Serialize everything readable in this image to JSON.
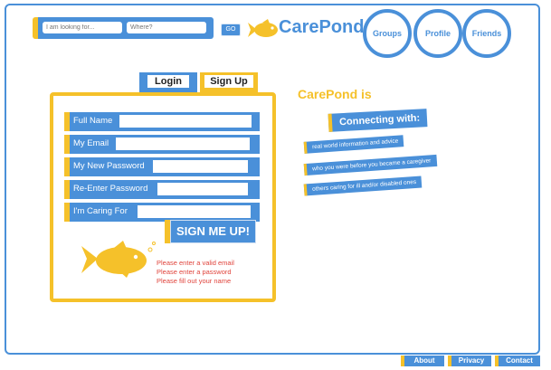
{
  "search": {
    "keyword_placeholder": "I am looking for...",
    "where_placeholder": "Where?",
    "go_label": "GO"
  },
  "brand": {
    "name": "CarePond"
  },
  "nav": {
    "groups": "Groups",
    "profile": "Profile",
    "friends": "Friends"
  },
  "tabs": {
    "login": "Login",
    "signup": "Sign Up"
  },
  "form": {
    "fields": [
      {
        "label": "Full Name"
      },
      {
        "label": "My Email"
      },
      {
        "label": "My New Password"
      },
      {
        "label": "Re-Enter Password"
      },
      {
        "label": "I'm Caring For"
      }
    ],
    "submit_label": "SIGN ME UP!",
    "errors": [
      "Please enter a valid email",
      "Please enter a password",
      "Please fill out your name"
    ]
  },
  "promo": {
    "tagline": "CarePond is",
    "heading": "Connecting with:",
    "items": [
      "real world information and advice",
      "who you were before you became a caregiver",
      "others caring for ill and/or disabled ones"
    ]
  },
  "footer": {
    "about": "About",
    "privacy": "Privacy",
    "contact": "Contact"
  },
  "colors": {
    "blue": "#4a90d9",
    "yellow": "#f5c12a",
    "error": "#e0443c"
  }
}
